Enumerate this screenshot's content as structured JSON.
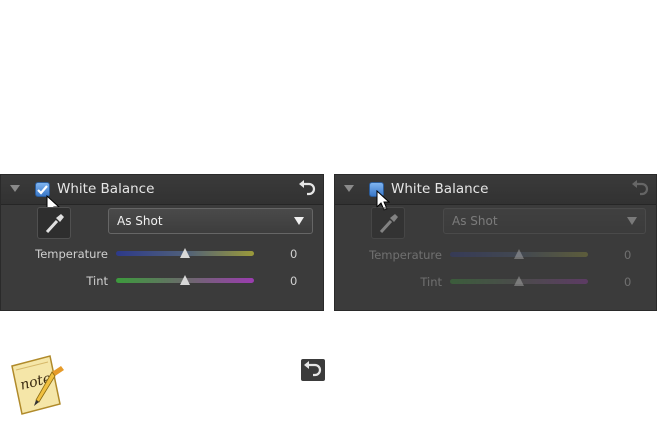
{
  "left_panel": {
    "title": "White Balance",
    "checked": true,
    "preset": "As Shot",
    "sliders": [
      {
        "label": "Temperature",
        "value": "0"
      },
      {
        "label": "Tint",
        "value": "0"
      }
    ]
  },
  "right_panel": {
    "title": "White Balance",
    "checked": false,
    "preset": "As Shot",
    "sliders": [
      {
        "label": "Temperature",
        "value": "0"
      },
      {
        "label": "Tint",
        "value": "0"
      }
    ]
  },
  "note": {
    "icon": "note-icon",
    "logo_text": "note"
  },
  "icons": {
    "collapse": "triangle-down-icon",
    "reset": "reset-arrow-icon",
    "eyedropper": "eyedropper-icon",
    "cursor": "mouse-cursor-icon"
  },
  "colors": {
    "panel_bg": "#3b3b3b",
    "checkbox_accent": "#4a8ad8"
  }
}
